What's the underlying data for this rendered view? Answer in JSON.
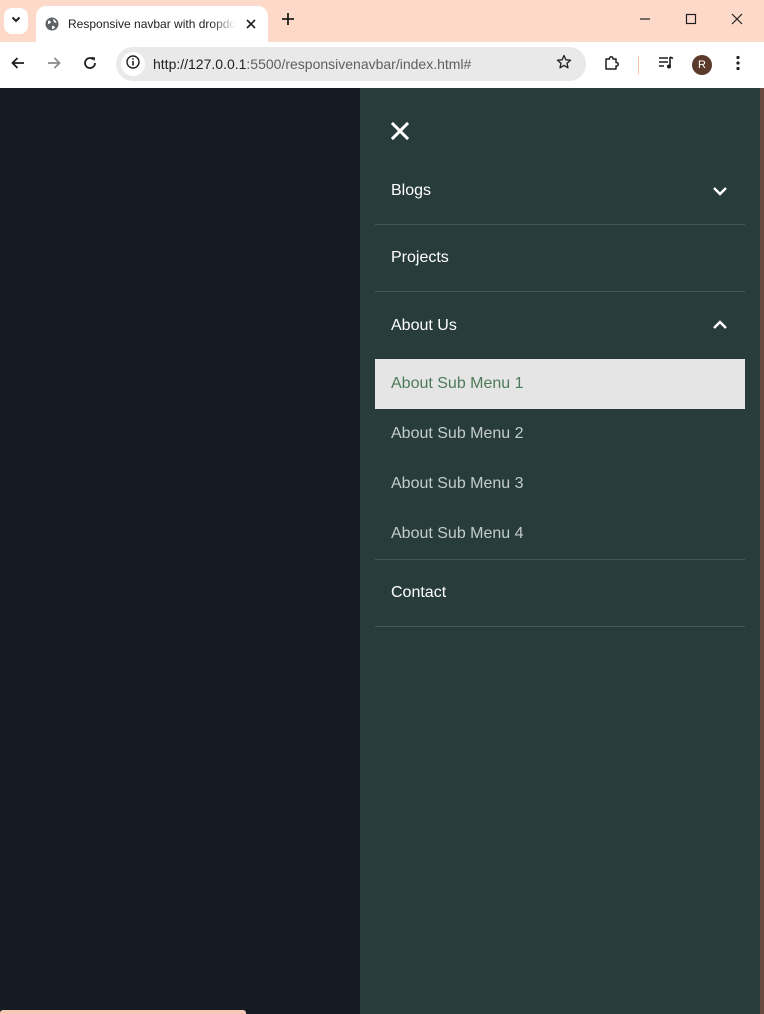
{
  "browser": {
    "tab_title": "Responsive navbar with dropdown",
    "url_host": "http://127.0.0.1",
    "url_rest": ":5500/responsivenavbar/index.html#",
    "profile_initial": "R"
  },
  "nav": {
    "items": [
      {
        "label": "Blogs",
        "has_dropdown": true,
        "expanded": false
      },
      {
        "label": "Projects",
        "has_dropdown": false
      },
      {
        "label": "About Us",
        "has_dropdown": true,
        "expanded": true
      },
      {
        "label": "Contact",
        "has_dropdown": false
      }
    ],
    "about_submenu": [
      {
        "label": "About Sub Menu 1",
        "active": true
      },
      {
        "label": "About Sub Menu 2",
        "active": false
      },
      {
        "label": "About Sub Menu 3",
        "active": false
      },
      {
        "label": "About Sub Menu 4",
        "active": false
      }
    ]
  },
  "colors": {
    "page_bg": "#141b22",
    "drawer_bg": "#283d3b",
    "active_sub_bg": "#e5e5e5",
    "active_sub_text": "#4d7a5a",
    "tabstrip_bg": "#fcd9c8"
  },
  "icons": {
    "drawer_close": "close-icon",
    "dropdown_collapsed": "chevron-down-icon",
    "dropdown_expanded": "chevron-up-icon"
  }
}
